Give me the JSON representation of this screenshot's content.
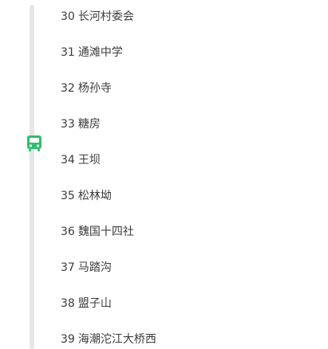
{
  "route": {
    "line_color": "#e6e6e6",
    "bus": {
      "icon": "bus-icon",
      "color": "#2fbe6e",
      "position_between_stops": [
        "33",
        "34"
      ]
    },
    "stops": [
      {
        "num": "30",
        "name": "长河村委会"
      },
      {
        "num": "31",
        "name": "通滩中学"
      },
      {
        "num": "32",
        "name": "杨孙寺"
      },
      {
        "num": "33",
        "name": "糖房"
      },
      {
        "num": "34",
        "name": "王坝"
      },
      {
        "num": "35",
        "name": "松林坳"
      },
      {
        "num": "36",
        "name": "魏国十四社"
      },
      {
        "num": "37",
        "name": "马踏沟"
      },
      {
        "num": "38",
        "name": "盟子山"
      },
      {
        "num": "39",
        "name": "海潮沱江大桥西"
      }
    ]
  }
}
